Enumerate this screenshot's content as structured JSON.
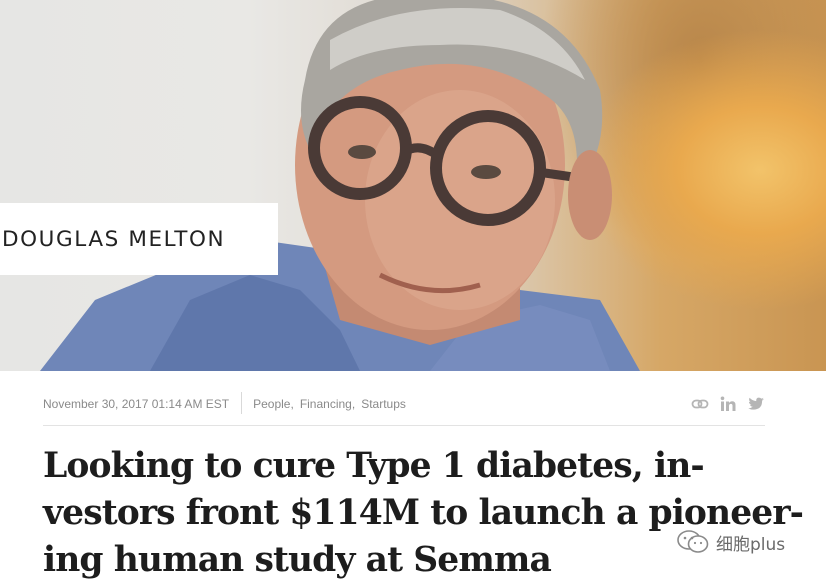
{
  "hero": {
    "name_label": "DOUGLAS MELTON"
  },
  "meta": {
    "date": "November 30, 2017 01:14 AM EST",
    "tags": [
      "People,",
      "Financing,",
      "Startups"
    ],
    "share_icons": [
      "link-icon",
      "linkedin-icon",
      "twitter-icon"
    ]
  },
  "headline": {
    "lines": [
      "Looking to cure Type 1 diabetes, in-",
      "vestors front $114M to launch a pioneer-",
      "ing human study at Semma"
    ]
  },
  "watermark": {
    "text": "细胞plus",
    "icon": "wechat-icon"
  },
  "colors": {
    "text_dark": "#1d1d1d",
    "meta_gray": "#8a8a8a",
    "icon_gray": "#b5b5b5"
  }
}
